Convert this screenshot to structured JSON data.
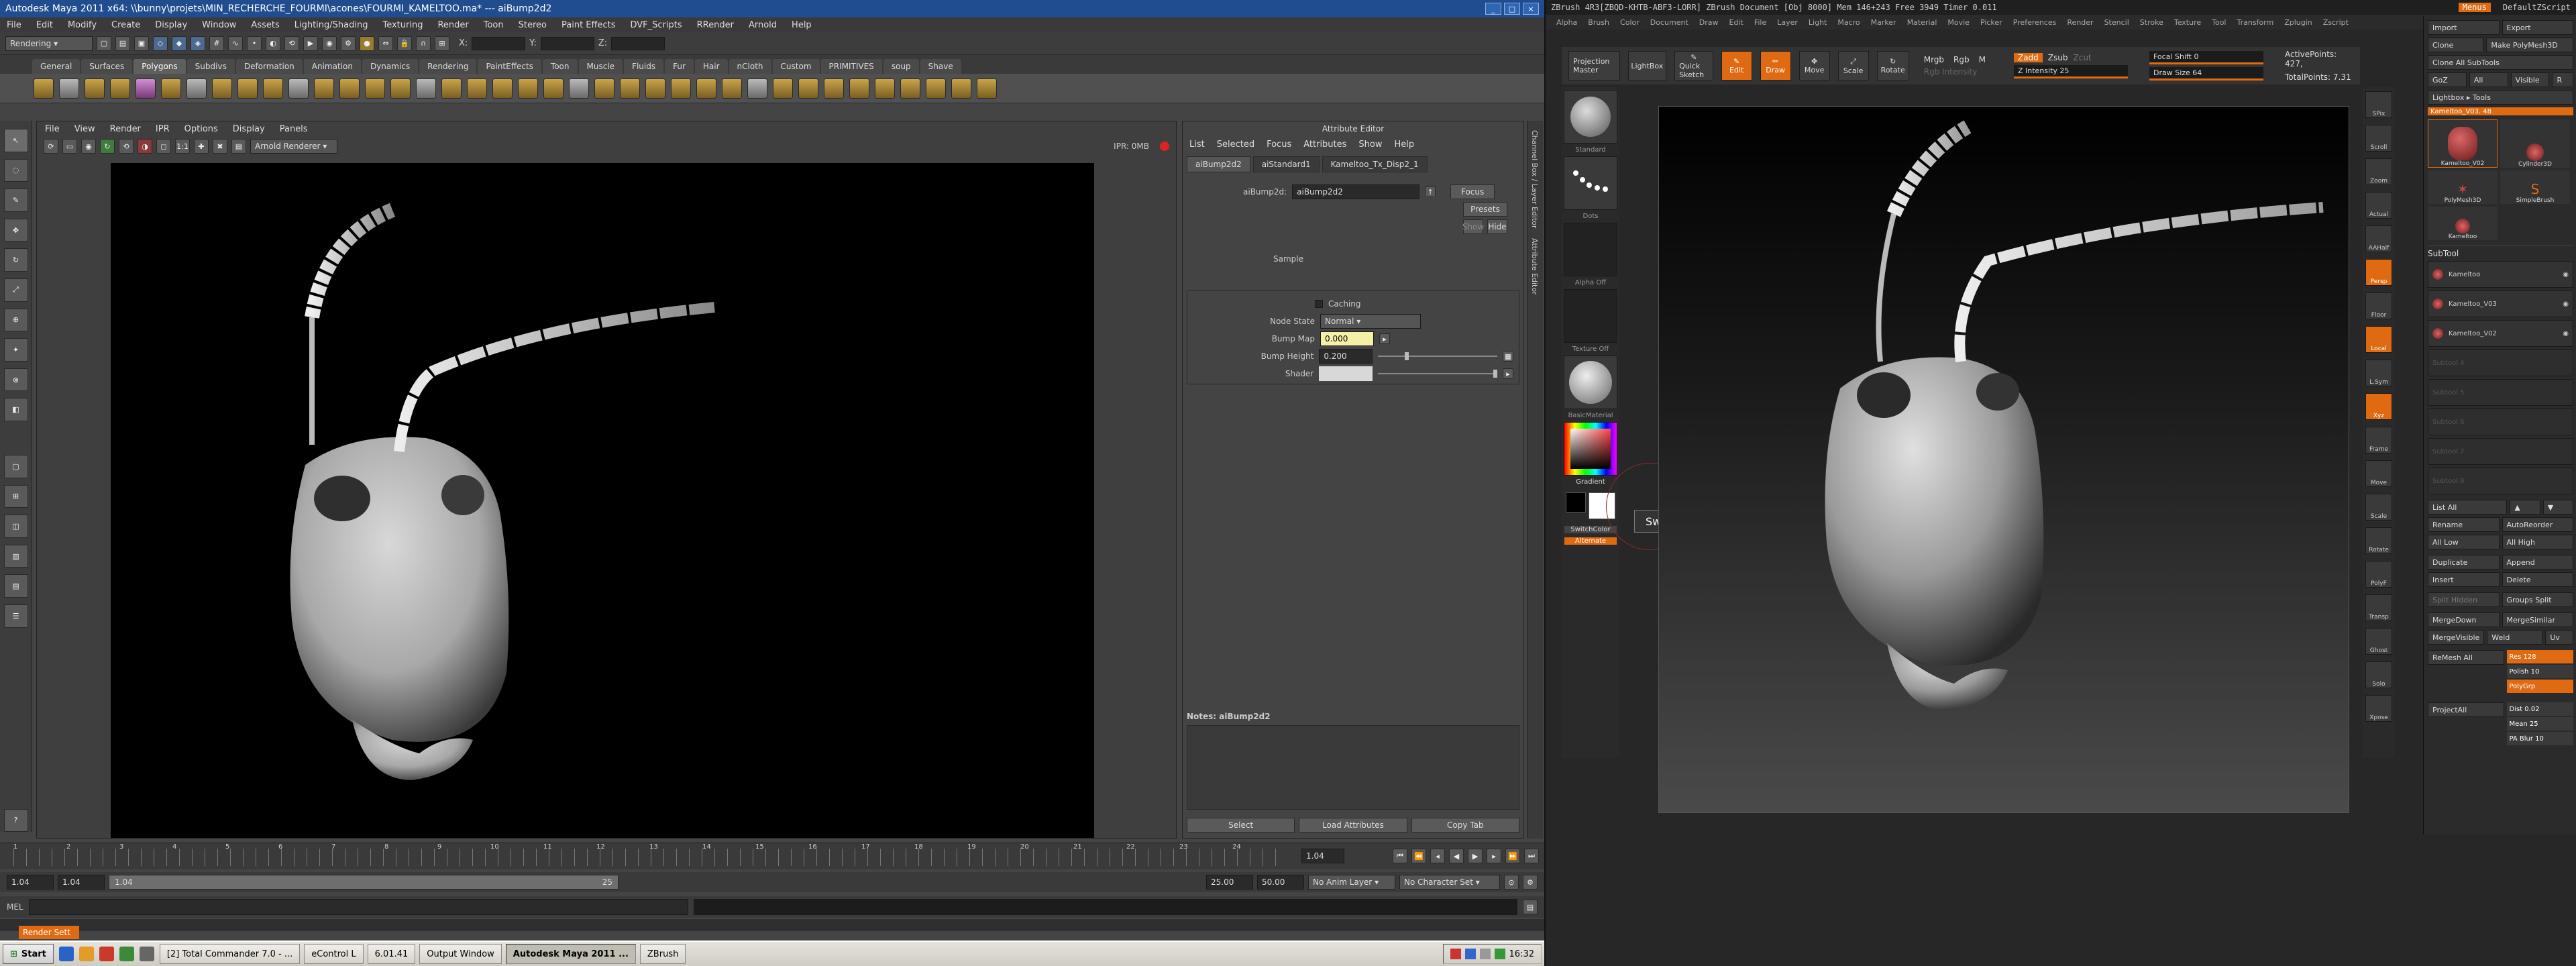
{
  "maya": {
    "title": "Autodesk Maya 2011 x64: \\\\bunny\\projets\\MIN_RECHERCHE_FOURMI\\acones\\FOURMI_KAMELTOO.ma* --- aiBump2d2",
    "menu": [
      "File",
      "Edit",
      "Modify",
      "Create",
      "Display",
      "Window",
      "Assets",
      "Lighting/Shading",
      "Texturing",
      "Render",
      "Toon",
      "Stereo",
      "Paint Effects",
      "DVF_Scripts",
      "RRender",
      "Arnold",
      "Help"
    ],
    "mode": "Rendering",
    "coords": {
      "x": "X:",
      "y": "Y:",
      "z": "Z:"
    },
    "shelf_tabs": [
      "General",
      "Surfaces",
      "Polygons",
      "Subdivs",
      "Deformation",
      "Animation",
      "Dynamics",
      "Rendering",
      "PaintEffects",
      "Toon",
      "Muscle",
      "Fluids",
      "Fur",
      "Hair",
      "nCloth",
      "Custom",
      "PRIMITIVES",
      "soup",
      "Shave"
    ],
    "active_shelf": "Polygons",
    "viewport": {
      "menu": [
        "File",
        "View",
        "Render",
        "IPR",
        "Options",
        "Display",
        "Panels"
      ],
      "renderer": "Arnold Renderer",
      "ratio": "1:1",
      "ipr": "IPR: 0MB"
    },
    "attr_editor": {
      "title": "Attribute Editor",
      "menu": [
        "List",
        "Selected",
        "Focus",
        "Attributes",
        "Show",
        "Help"
      ],
      "tabs": [
        "aiBump2d2",
        "aiStandard1",
        "Kameltoo_Tx_Disp2_1"
      ],
      "node_label": "aiBump2d:",
      "node_value": "aiBump2d2",
      "focus": "Focus",
      "presets": "Presets",
      "show": "Show",
      "hide": "Hide",
      "sample": "Sample",
      "caching": "Caching",
      "node_state_label": "Node State",
      "node_state_value": "Normal",
      "bump_map_label": "Bump Map",
      "bump_map_value": "0.000",
      "bump_height_label": "Bump Height",
      "bump_height_value": "0.200",
      "shader_label": "Shader",
      "notes_label": "Notes: aiBump2d2",
      "select": "Select",
      "load_attrs": "Load Attributes",
      "copy_tab": "Copy Tab"
    },
    "side_labels": [
      "Channel Box / Layer Editor",
      "Attribute Editor"
    ],
    "timeline": {
      "labels": [
        "1",
        "2",
        "3",
        "4",
        "5",
        "6",
        "7",
        "8",
        "9",
        "10",
        "11",
        "12",
        "13",
        "14",
        "15",
        "16",
        "17",
        "18",
        "19",
        "20",
        "21",
        "22",
        "23",
        "24"
      ],
      "current": "1.04"
    },
    "range": {
      "start": "1.04",
      "inner_start": "1.04",
      "bar_start": "1.04",
      "bar_end": "25",
      "end": "25.00",
      "outer_end": "50.00",
      "anim_layer": "No Anim Layer",
      "char_set": "No Character Set"
    },
    "mel_label": "MEL"
  },
  "taskbar": {
    "start": "Start",
    "render_label": "Render Sett",
    "items": [
      "[2] Total Commander 7.0 - ...",
      "eControl L",
      "6.01.41",
      "Output Window",
      "Autodesk Maya 2011 ...",
      "ZBrush"
    ],
    "active": "Autodesk Maya 2011 ...",
    "clock": "16:32"
  },
  "zbrush": {
    "title": "ZBrush 4R3[ZBQD-KHTB-ABF3-LORR]   ZBrush Document   [Obj 8000] Mem 146+243 Free 3949 Timer 0.011",
    "menu_button": "Menus",
    "script": "DefaultZScript",
    "menu": [
      "Alpha",
      "Brush",
      "Color",
      "Document",
      "Draw",
      "Edit",
      "File",
      "Layer",
      "Light",
      "Macro",
      "Marker",
      "Material",
      "Movie",
      "Picker",
      "Preferences",
      "Render",
      "Stencil",
      "Stroke",
      "Texture",
      "Tool",
      "Transform",
      "Zplugin",
      "Zscript"
    ],
    "top_buttons": [
      "Projection Master",
      "LightBox",
      "Quick Sketch",
      "Edit",
      "Draw",
      "Move",
      "Scale",
      "Rotate"
    ],
    "mrgb": "Mrgb",
    "rgb": "Rgb",
    "m": "M",
    "rgb_intensity": "Rgb Intensity",
    "zadd": "Zadd",
    "zsub": "Zsub",
    "zcut": "Zcut",
    "z_intensity": "Z Intensity 25",
    "focal_shift": "Focal Shift 0",
    "draw_size": "Draw Size 64",
    "active_points": "ActivePoints: 427,",
    "total_points": "TotalPoints: 7.31",
    "left_shelf": {
      "brush": "Standard",
      "stroke": "Dots",
      "alpha": "Alpha Off",
      "texture": "Texture Off",
      "material": "BasicMaterial",
      "gradient": "Gradient",
      "switchcolor": "SwitchColor",
      "alternate": "Alternate"
    },
    "tooltip": {
      "text": "Switch Colors",
      "key": "V"
    },
    "right_shelf": [
      "SPix",
      "Scroll",
      "Zoom",
      "Actual",
      "AAHalf",
      "Persp",
      "Floor",
      "Local",
      "L.Sym",
      "Xyz",
      "Frame",
      "Move",
      "Scale",
      "Rotate",
      "PolyF",
      "Transp",
      "Ghost",
      "Solo",
      "Xpose"
    ],
    "tray": {
      "import": "Import",
      "export": "Export",
      "clone": "Clone",
      "make_polymesh": "Make PolyMesh3D",
      "clone_all": "Clone All SubTools",
      "goz": "GoZ",
      "all": "All",
      "visible": "Visible",
      "r": "R",
      "lightbox_tools": "Lightbox ▸ Tools",
      "current_tool": "Kameltoo_V03. 48",
      "tools": [
        "Kameltoo_V02",
        "Cylinder3D",
        "PolyMesh3D",
        "SimpleBrush",
        "Kameltoo"
      ],
      "subtool_header": "SubTool",
      "subtools": [
        "Kameltoo",
        "Kameltoo_V03",
        "Kameltoo_V02"
      ],
      "empty_subtools": [
        "Subtool 4",
        "Subtool 5",
        "Subtool 6",
        "Subtool 7",
        "Subtool 8"
      ],
      "list_all": "List All",
      "rename": "Rename",
      "auto_reorder": "AutoReorder",
      "all_low": "All Low",
      "all_high": "All High",
      "duplicate": "Duplicate",
      "append": "Append",
      "insert": "Insert",
      "delete": "Delete",
      "split_hidden": "Split Hidden",
      "groups_split": "Groups Split",
      "merge_down": "MergeDown",
      "merge_similar": "MergeSimilar",
      "merge_visible": "MergeVisible",
      "weld": "Weld",
      "uv": "Uv",
      "remesh_all": "ReMesh All",
      "res": "Res 128",
      "polish": "Polish 10",
      "polygrp": "PolyGrp",
      "project_all": "ProjectAll",
      "dist": "Dist 0.02",
      "mean": "Mean 25",
      "pa_blur": "PA Blur 10"
    }
  }
}
